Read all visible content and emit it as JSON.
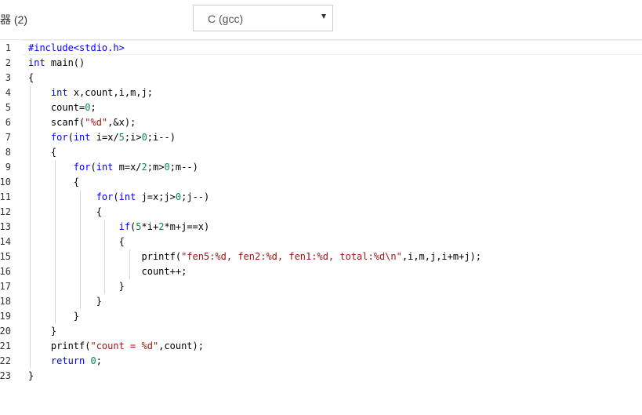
{
  "header": {
    "title": "器 (2)",
    "language_select": {
      "value": "C (gcc)"
    }
  },
  "editor": {
    "line_numbers": [
      "1",
      "2",
      "3",
      "4",
      "5",
      "6",
      "7",
      "8",
      "9",
      "10",
      "11",
      "12",
      "13",
      "14",
      "15",
      "16",
      "17",
      "18",
      "19",
      "20",
      "21",
      "22",
      "23"
    ],
    "lines": [
      "#include<stdio.h>",
      "int main()",
      "{",
      "    int x,count,i,m,j;",
      "    count=0;",
      "    scanf(\"%d\",&x);",
      "    for(int i=x/5;i>0;i--)",
      "    {",
      "        for(int m=x/2;m>0;m--)",
      "        {",
      "            for(int j=x;j>0;j--)",
      "            {",
      "                if(5*i+2*m+j==x)",
      "                {",
      "                    printf(\"fen5:%d, fen2:%d, fen1:%d, total:%d\\n\",i,m,j,i+m+j);",
      "                    count++;",
      "                }",
      "            }",
      "        }",
      "    }",
      "    printf(\"count = %d\",count);",
      "    return 0;",
      "}"
    ]
  }
}
